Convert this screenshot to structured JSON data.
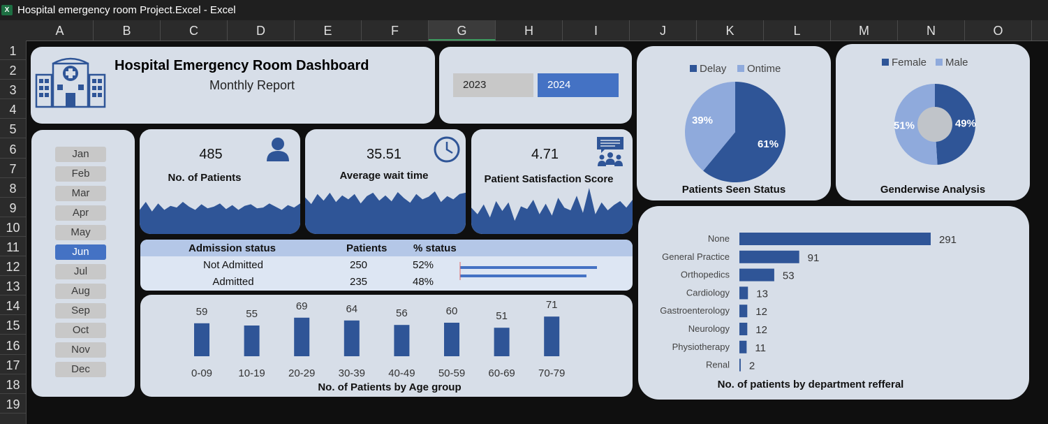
{
  "window": {
    "title": "Hospital emergency room Project.Excel - Excel"
  },
  "columns": [
    "A",
    "B",
    "C",
    "D",
    "E",
    "F",
    "G",
    "H",
    "I",
    "J",
    "K",
    "L",
    "M",
    "N",
    "O"
  ],
  "rows": [
    "1",
    "2",
    "3",
    "4",
    "5",
    "6",
    "7",
    "8",
    "9",
    "10",
    "11",
    "12",
    "13",
    "14",
    "15",
    "16",
    "17",
    "18",
    "19"
  ],
  "selected_column": "G",
  "header": {
    "title": "Hospital Emergency Room Dashboard",
    "subtitle": "Monthly Report"
  },
  "years": {
    "items": [
      "2023",
      "2024"
    ],
    "selected": "2024"
  },
  "months": {
    "items": [
      "Jan",
      "Feb",
      "Mar",
      "Apr",
      "May",
      "Jun",
      "Jul",
      "Aug",
      "Sep",
      "Oct",
      "Nov",
      "Dec"
    ],
    "selected": "Jun"
  },
  "kpis": {
    "patients": {
      "value": "485",
      "label": "No. of Patients",
      "icon": "person-icon"
    },
    "wait": {
      "value": "35.51",
      "label": "Average wait time",
      "icon": "clock-icon"
    },
    "satisfaction": {
      "value": "4.71",
      "label": "Patient Satisfaction Score",
      "icon": "meeting-icon"
    }
  },
  "admission": {
    "headers": [
      "Admission status",
      "Patients",
      "% status"
    ],
    "rows": [
      {
        "status": "Not Admitted",
        "patients": "250",
        "pct": "52%",
        "fraction": 0.52
      },
      {
        "status": "Admitted",
        "patients": "235",
        "pct": "48%",
        "fraction": 0.48
      }
    ]
  },
  "colors": {
    "dark": "#2f5597",
    "light": "#8faadc",
    "accent": "#4472c4",
    "panel": "#d7dee8"
  },
  "chart_data": [
    {
      "type": "pie",
      "title": "Patients Seen Status",
      "legend": "top",
      "series": [
        {
          "name": "Delay",
          "value": 61,
          "label": "61%"
        },
        {
          "name": "Ontime",
          "value": 39,
          "label": "39%"
        }
      ]
    },
    {
      "type": "pie",
      "subtype": "donut",
      "title": "Genderwise Analysis",
      "legend": "top",
      "series": [
        {
          "name": "Female",
          "value": 49,
          "label": "49%"
        },
        {
          "name": "Male",
          "value": 51,
          "label": "51%"
        }
      ]
    },
    {
      "type": "bar",
      "title": "No. of Patients by Age group",
      "categories": [
        "0-09",
        "10-19",
        "20-29",
        "30-39",
        "40-49",
        "50-59",
        "60-69",
        "70-79"
      ],
      "values": [
        59,
        55,
        69,
        64,
        56,
        60,
        51,
        71
      ],
      "ylim": [
        0,
        80
      ]
    },
    {
      "type": "bar",
      "orientation": "horizontal",
      "title": "No. of patients by department refferal",
      "categories": [
        "None",
        "General Practice",
        "Orthopedics",
        "Cardiology",
        "Gastroenterology",
        "Neurology",
        "Physiotherapy",
        "Renal"
      ],
      "values": [
        291,
        91,
        53,
        13,
        12,
        12,
        11,
        2
      ],
      "xlim": [
        0,
        291
      ]
    },
    {
      "type": "area",
      "title": "",
      "series": [
        {
          "name": "",
          "values": [
            30,
            40,
            28,
            38,
            30,
            35,
            33,
            40,
            34,
            30,
            37,
            32,
            34,
            38,
            31,
            36,
            30,
            35,
            37,
            32,
            33,
            38,
            34,
            30,
            36,
            33,
            38
          ]
        }
      ]
    },
    {
      "type": "area",
      "title": "",
      "series": [
        {
          "name": "",
          "values": [
            55,
            45,
            60,
            50,
            62,
            48,
            58,
            52,
            60,
            46,
            57,
            62,
            50,
            58,
            49,
            63,
            54,
            47,
            60,
            52,
            56,
            64,
            48,
            57,
            52,
            60,
            62
          ]
        }
      ]
    },
    {
      "type": "area",
      "title": "",
      "series": [
        {
          "name": "",
          "values": [
            40,
            30,
            45,
            25,
            50,
            35,
            48,
            20,
            42,
            38,
            52,
            30,
            46,
            28,
            55,
            40,
            36,
            58,
            32,
            70,
            30,
            48,
            36,
            44,
            50,
            40,
            52
          ]
        }
      ]
    }
  ]
}
